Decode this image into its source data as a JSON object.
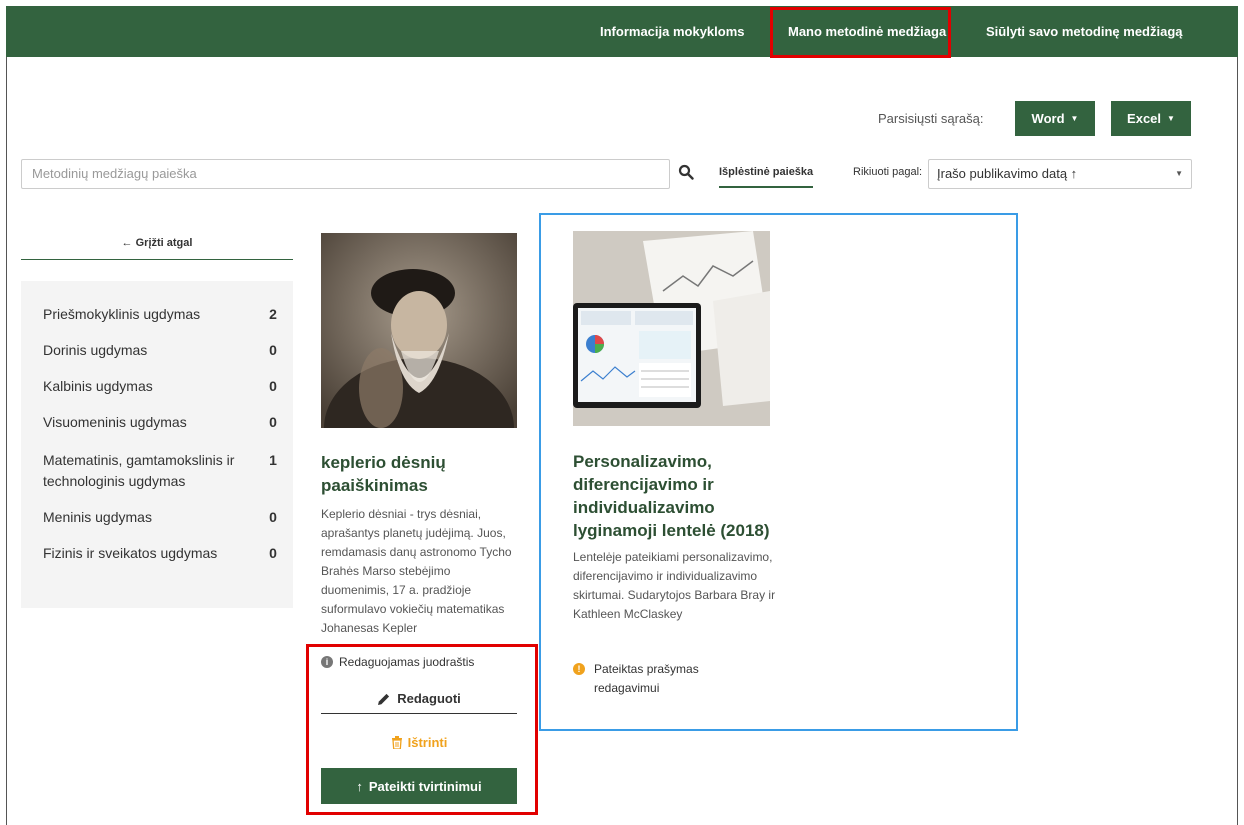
{
  "nav": {
    "info": "Informacija mokykloms",
    "my": "Mano metodinė medžiaga",
    "suggest": "Siūlyti savo metodinę medžiagą"
  },
  "download": {
    "label": "Parsisiųsti sąrašą:",
    "word": "Word",
    "excel": "Excel"
  },
  "search": {
    "placeholder": "Metodinių medžiagų paieška",
    "advanced": "Išplėstinė paieška"
  },
  "sort": {
    "label": "Rikiuoti pagal:",
    "value": "Įrašo publikavimo datą ↑"
  },
  "sidebar": {
    "back": "Grįžti atgal",
    "categories": [
      {
        "label": "Priešmokyklinis ugdymas",
        "count": "2"
      },
      {
        "label": "Dorinis ugdymas",
        "count": "0"
      },
      {
        "label": "Kalbinis ugdymas",
        "count": "0"
      },
      {
        "label": "Visuomeninis ugdymas",
        "count": "0"
      },
      {
        "label": "Matematinis, gamtamokslinis ir technologinis ugdymas",
        "count": "1"
      },
      {
        "label": "Meninis ugdymas",
        "count": "0"
      },
      {
        "label": "Fizinis ir sveikatos ugdymas",
        "count": "0"
      }
    ]
  },
  "cards": [
    {
      "title": "keplerio dėsnių paaiškinimas",
      "desc": "Keplerio dėsniai - trys dėsniai, aprašantys planetų judėjimą. Juos, remdamasis danų astronomo Tycho Brahės Marso stebėjimo duomenimis, 17 a. pradžioje suformulavo vokiečių matematikas Johanesas Kepler",
      "status": "Redaguojamas juodraštis",
      "edit": "Redaguoti",
      "delete": "Ištrinti",
      "submit": "Pateikti tvirtinimui"
    },
    {
      "title": "Personalizavimo, diferencijavimo ir individualizavimo lyginamoji lentelė (2018)",
      "desc": "Lentelėje pateikiami personalizavimo, diferencijavimo ir individualizavimo skirtumai. Sudarytojos Barbara Bray ir Kathleen McClaskey",
      "status": "Pateiktas prašymas redagavimui"
    }
  ],
  "colors": {
    "brand": "#33633f",
    "highlight": "#e10000",
    "selection": "#3a9ce6",
    "warning": "#f0a21d"
  }
}
